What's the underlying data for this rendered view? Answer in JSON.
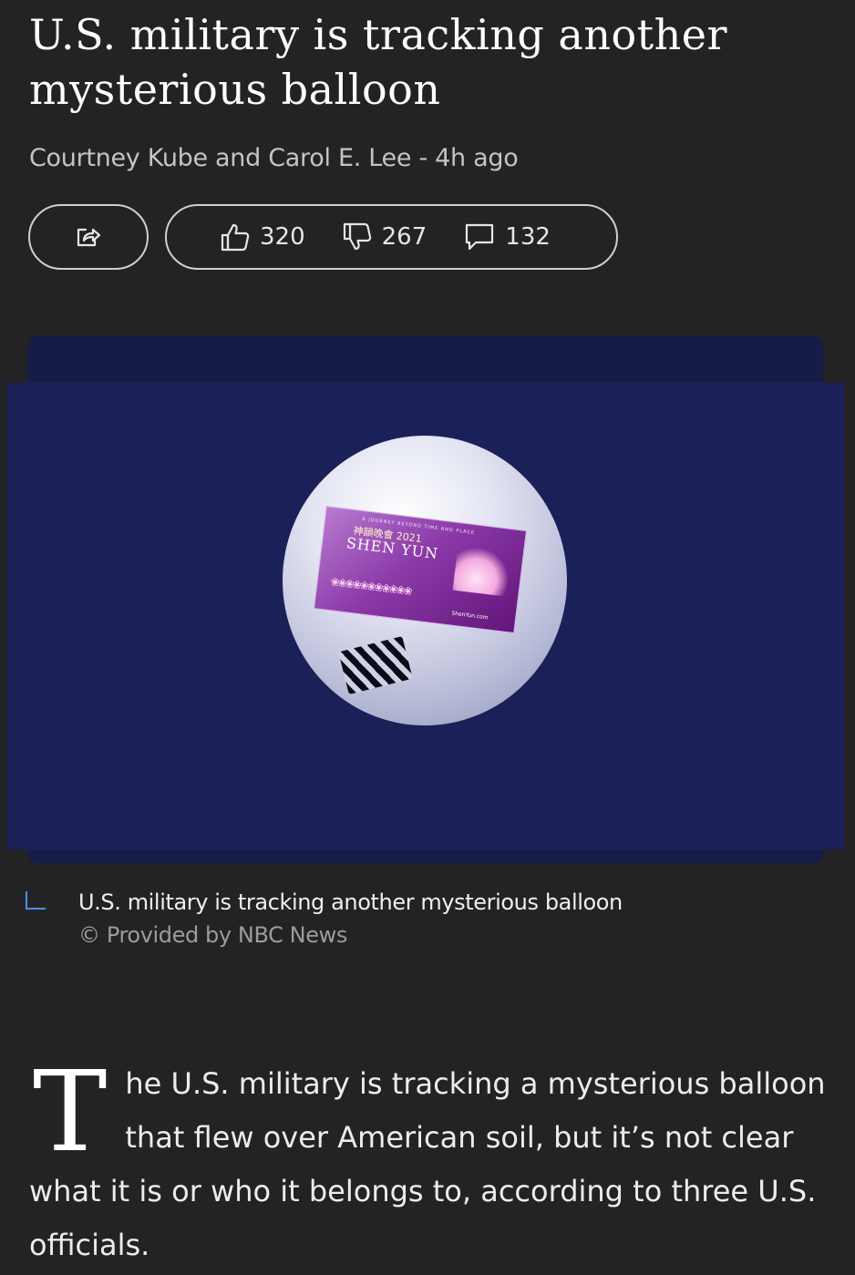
{
  "article": {
    "headline": "U.S. military is tracking another mysterious balloon",
    "byline": "Courtney Kube and Carol E. Lee - 4h ago",
    "dropcap": "T",
    "body": "he U.S. military is tracking a mysterious balloon that flew over American soil, but it’s not clear what it is or who it belongs to, according to three U.S. officials."
  },
  "actions": {
    "share_icon": "share-icon",
    "reactions": [
      {
        "icon": "thumbs-up-icon",
        "count": "320"
      },
      {
        "icon": "thumbs-down-icon",
        "count": "267"
      },
      {
        "icon": "comment-icon",
        "count": "132"
      }
    ]
  },
  "image": {
    "caption": "U.S. military is tracking another mysterious balloon",
    "credit": "© Provided by NBC News",
    "ticket": {
      "small_text": "A JOURNEY BEYOND TIME AND PLACE",
      "chinese_text": "神韻晚會 2021",
      "title": "SHEN YUN",
      "site": "ShenYun.com"
    }
  },
  "colors": {
    "background": "#232325",
    "image_backdrop": "#1c2058",
    "caption_accent": "#4a8fe8"
  }
}
